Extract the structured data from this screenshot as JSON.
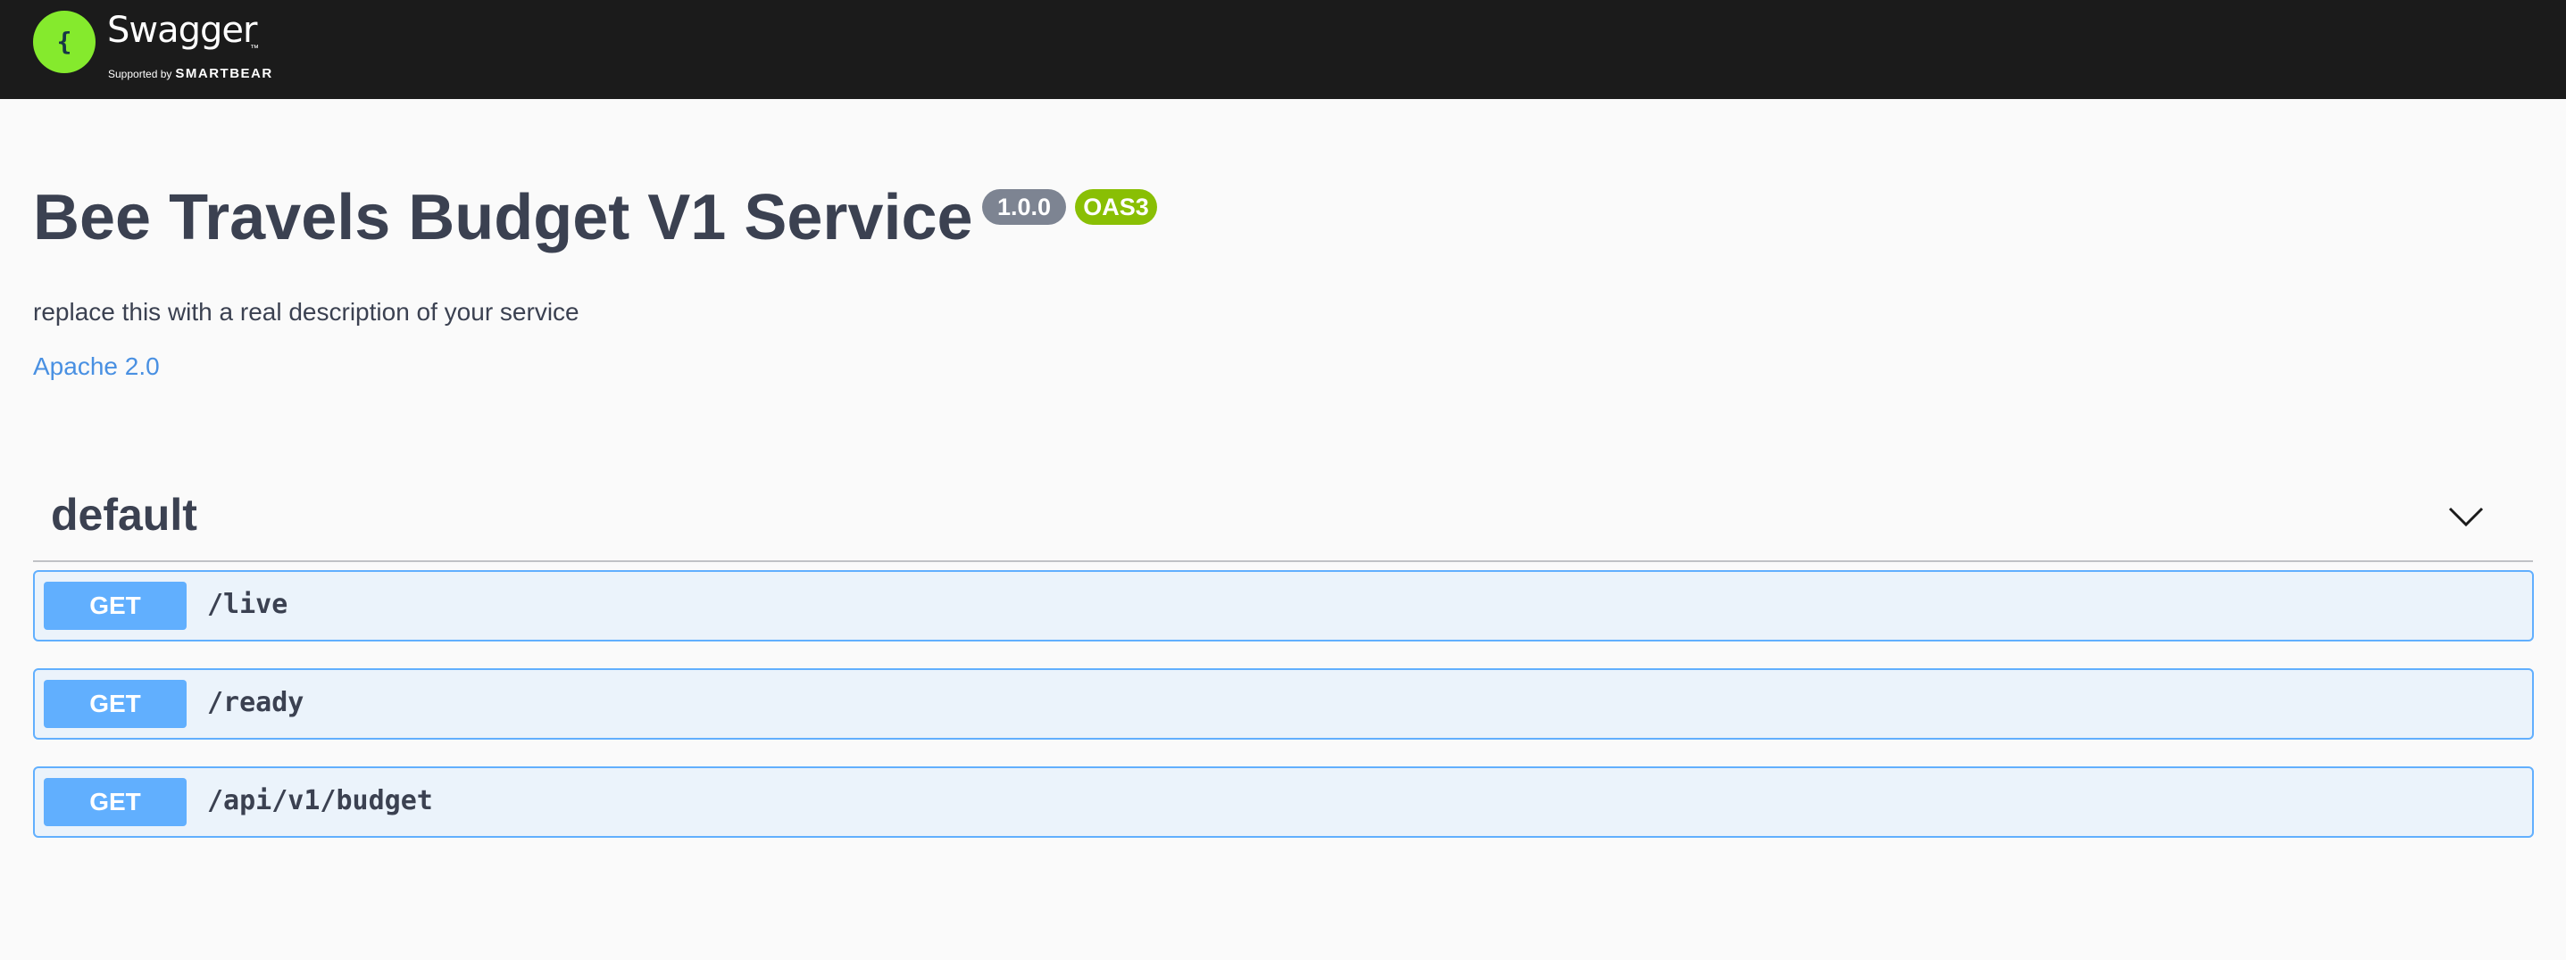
{
  "topbar": {
    "logo_icon": "swagger-braces-icon",
    "brand_name": "Swagger",
    "brand_tm": "™",
    "supported_by": "Supported by",
    "smartbear": "SMARTBEAR",
    "logo_color": "#85ea2d",
    "bar_color": "#1b1b1b"
  },
  "info": {
    "title": "Bee Travels Budget V1 Service",
    "version": "1.0.0",
    "oas_badge": "OAS3",
    "description": "replace this with a real description of your service",
    "license": "Apache 2.0"
  },
  "tag": {
    "name": "default",
    "toggle_icon": "chevron-down-icon"
  },
  "operations": [
    {
      "method": "GET",
      "path": "/live"
    },
    {
      "method": "GET",
      "path": "/ready"
    },
    {
      "method": "GET",
      "path": "/api/v1/budget"
    }
  ],
  "colors": {
    "get_method": "#61affe",
    "get_background": "#ebf3fb",
    "link": "#4990e2",
    "oas_badge": "#89bf04",
    "version_badge": "#7d8492"
  }
}
